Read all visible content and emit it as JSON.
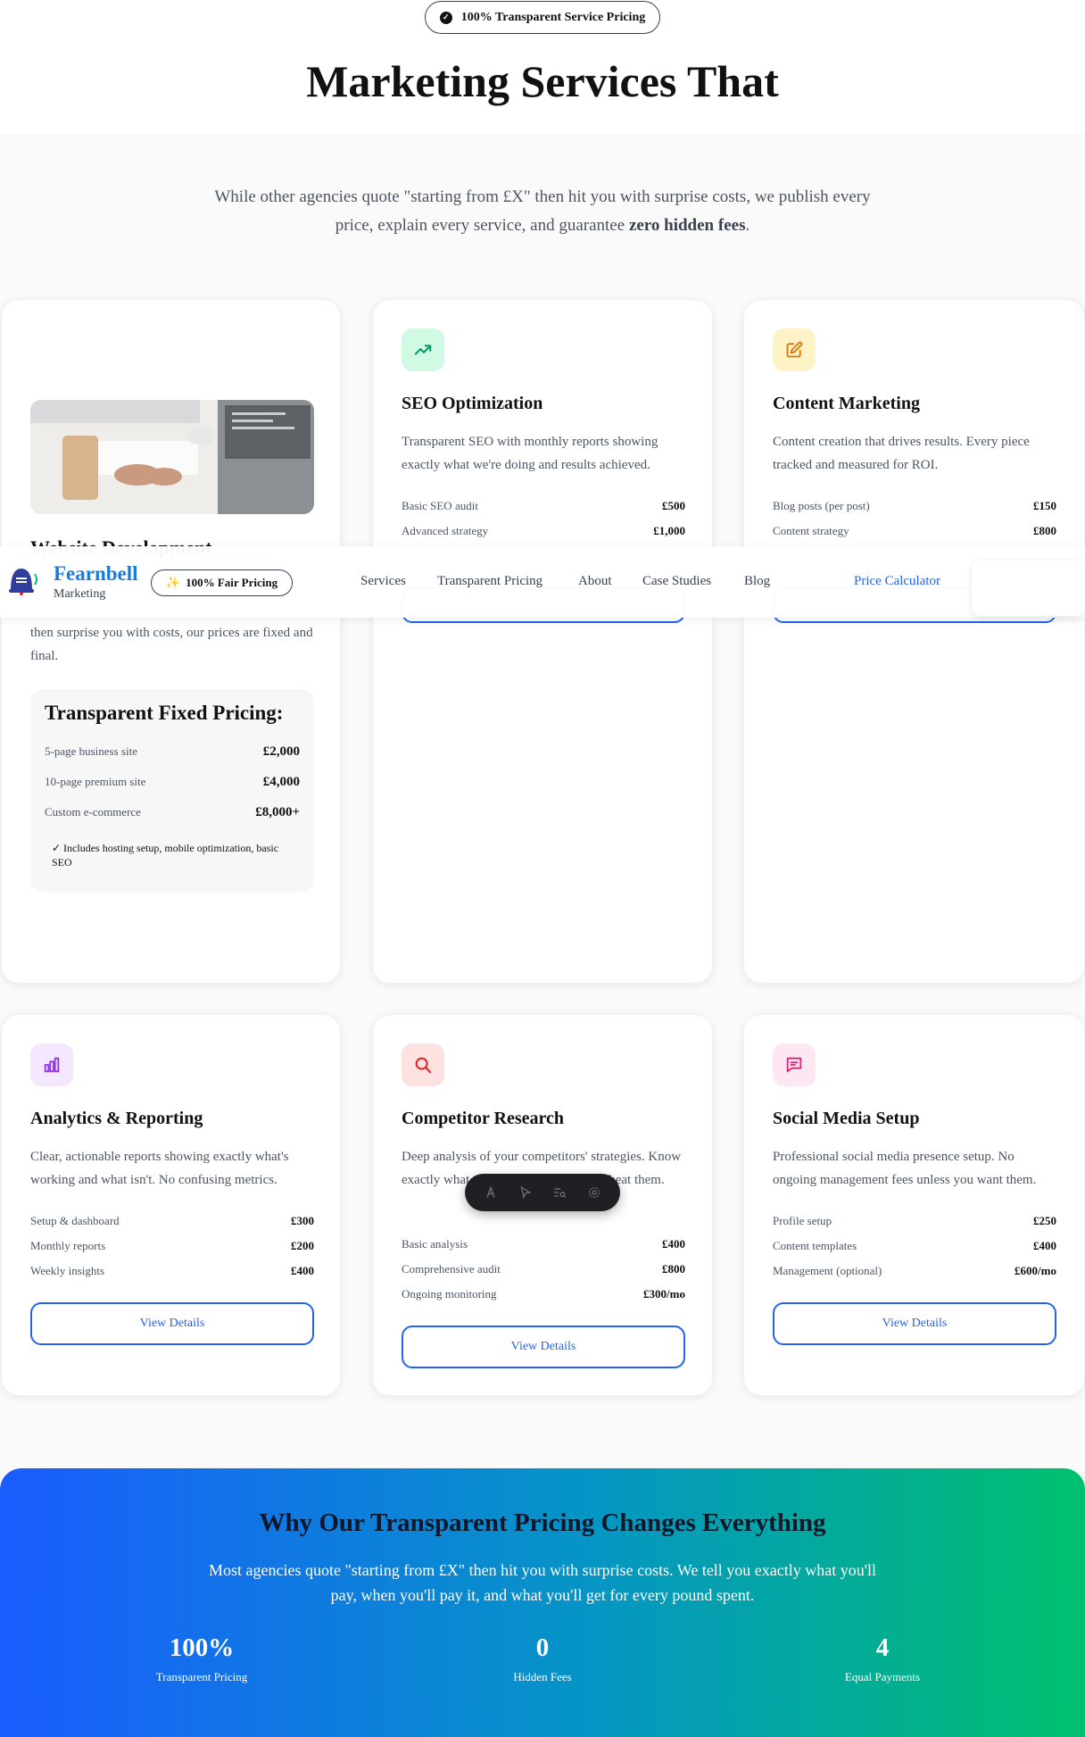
{
  "hero": {
    "badge": "100% Transparent Service Pricing",
    "title": "Marketing Services That",
    "subtitle_pre": "While other agencies quote \"starting from £X\" then hit you with surprise costs, we publish every price, explain every service, and guarantee ",
    "subtitle_bold": "zero hidden fees",
    "subtitle_post": "."
  },
  "web_card": {
    "title": "Website Development",
    "desc": "then surprise you with costs, our prices are fixed and final.",
    "box_title": "Transparent Fixed Pricing:",
    "rows": [
      {
        "label": "5-page business site",
        "value": "£2,000"
      },
      {
        "label": "10-page premium site",
        "value": "£4,000"
      },
      {
        "label": "Custom e-commerce",
        "value": "£8,000+"
      }
    ],
    "note": "✓ Includes hosting setup, mobile optimization, basic SEO"
  },
  "cards": [
    {
      "title": "SEO Optimization",
      "desc": "Transparent SEO with monthly reports showing exactly what we're doing and results achieved.",
      "icon": "trending-up-icon",
      "icon_bg": "#d1fae5",
      "icon_color": "#059669",
      "rows": [
        {
          "label": "Basic SEO audit",
          "value": "£500"
        },
        {
          "label": "Advanced strategy",
          "value": "£1,000"
        }
      ]
    },
    {
      "title": "Content Marketing",
      "desc": "Content creation that drives results. Every piece tracked and measured for ROI.",
      "icon": "edit-icon",
      "icon_bg": "#fef3c7",
      "icon_color": "#d97706",
      "rows": [
        {
          "label": "Blog posts (per post)",
          "value": "£150"
        },
        {
          "label": "Content strategy",
          "value": "£800"
        }
      ]
    },
    {
      "title": "Analytics & Reporting",
      "desc": "Clear, actionable reports showing exactly what's working and what isn't. No confusing metrics.",
      "icon": "bar-chart-icon",
      "icon_bg": "#f3e8ff",
      "icon_color": "#9333ea",
      "rows": [
        {
          "label": "Setup & dashboard",
          "value": "£300"
        },
        {
          "label": "Monthly reports",
          "value": "£200"
        },
        {
          "label": "Weekly insights",
          "value": "£400"
        }
      ],
      "button": "View Details"
    },
    {
      "title": "Competitor Research",
      "desc": "Deep analysis of your competitors' strategies. Know exactly what they're doing and how to beat them.",
      "icon": "search-icon",
      "icon_bg": "#fee2e2",
      "icon_color": "#dc2626",
      "rows": [
        {
          "label": "Basic analysis",
          "value": "£400"
        },
        {
          "label": "Comprehensive audit",
          "value": "£800"
        },
        {
          "label": "Ongoing monitoring",
          "value": "£300/mo"
        }
      ],
      "button": "View Details"
    },
    {
      "title": "Social Media Setup",
      "desc": "Professional social media presence setup. No ongoing management fees unless you want them.",
      "icon": "message-icon",
      "icon_bg": "#fce7f3",
      "icon_color": "#db2777",
      "rows": [
        {
          "label": "Profile setup",
          "value": "£250"
        },
        {
          "label": "Content templates",
          "value": "£400"
        },
        {
          "label": "Management (optional)",
          "value": "£600/mo"
        }
      ],
      "button": "View Details"
    }
  ],
  "nav": {
    "brand": "Fearnbell",
    "brand_sub": "Marketing",
    "badge": "100% Fair Pricing",
    "items": [
      "Services",
      "Transparent Pricing",
      "About",
      "Case Studies",
      "Blog"
    ],
    "cta": "Price Calculator"
  },
  "cta": {
    "title": "Why Our Transparent Pricing Changes Everything",
    "subtitle": "Most agencies quote \"starting from £X\" then hit you with surprise costs. We tell you exactly what you'll pay, when you'll pay it, and what you'll get for every pound spent.",
    "stats": [
      {
        "number": "100%",
        "label": "Transparent Pricing"
      },
      {
        "number": "0",
        "label": "Hidden Fees"
      },
      {
        "number": "4",
        "label": "Equal Payments"
      }
    ]
  },
  "colors": {
    "brand_blue": "#2563eb",
    "gradient_start": "#1a5cff",
    "gradient_end": "#00c06e"
  }
}
